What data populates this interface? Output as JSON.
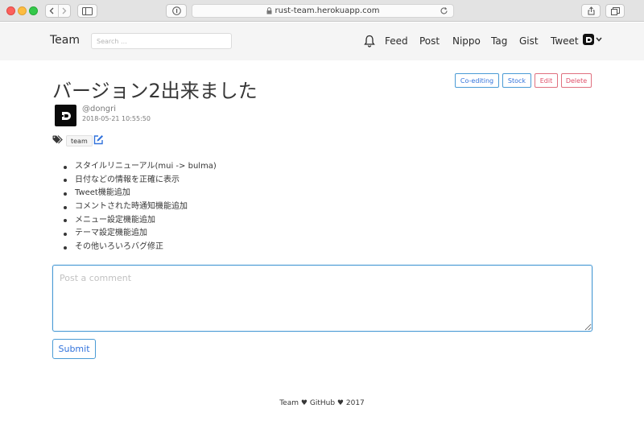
{
  "browser": {
    "url": "rust-team.herokuapp.com",
    "new_tab_glyph": "+"
  },
  "navbar": {
    "brand": "Team",
    "search_placeholder": "Search ...",
    "links": [
      "Feed",
      "Post",
      "Nippo",
      "Tag",
      "Gist",
      "Tweet"
    ],
    "user_initial": "D"
  },
  "post": {
    "title": "バージョン2出来ました",
    "actions": {
      "coediting": "Co-editing",
      "stock": "Stock",
      "edit": "Edit",
      "delete": "Delete"
    },
    "author": {
      "username": "@dongri",
      "avatar_initial": "D"
    },
    "timestamp": "2018-05-21 10:55:50",
    "tags": [
      "team"
    ],
    "body_items": [
      "スタイルリニューアル(mui -> bulma)",
      "日付などの情報を正確に表示",
      "Tweet機能追加",
      "コメントされた時通知機能追加",
      "メニュー設定機能追加",
      "テーマ設定機能追加",
      "その他いろいろバグ修正"
    ]
  },
  "comment": {
    "placeholder": "Post a comment",
    "submit_label": "Submit"
  },
  "footer": {
    "part1": "Team",
    "part2": "GitHub",
    "part3": "2017",
    "heart": "♥"
  },
  "colors": {
    "info": "#3273dc",
    "danger": "#e0506a",
    "navbar_bg": "#f5f5f5"
  }
}
